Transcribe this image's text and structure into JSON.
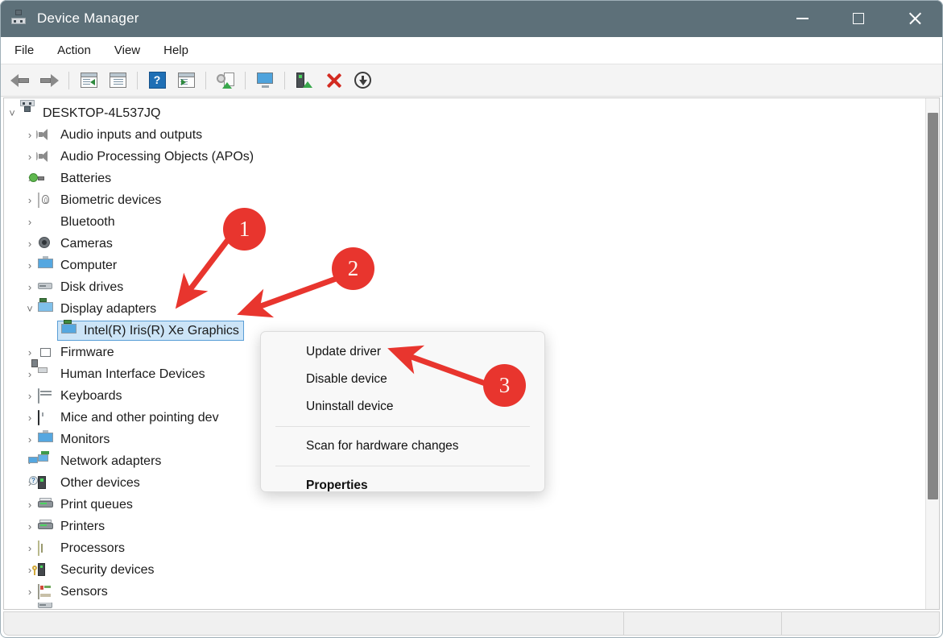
{
  "window": {
    "title": "Device Manager",
    "icon": "device-manager-icon",
    "controls": {
      "minimize": "minimize-icon",
      "maximize": "maximize-icon",
      "close": "close-icon"
    },
    "titlebar_color": "#5d7079"
  },
  "menubar": {
    "items": [
      {
        "label": "File"
      },
      {
        "label": "Action"
      },
      {
        "label": "View"
      },
      {
        "label": "Help"
      }
    ]
  },
  "toolbar": {
    "buttons": [
      {
        "name": "back-button",
        "icon": "back-arrow-icon"
      },
      {
        "name": "forward-button",
        "icon": "forward-arrow-icon"
      },
      {
        "name": "show-hide-console-tree-button",
        "icon": "console-tree-icon"
      },
      {
        "name": "properties-button",
        "icon": "properties-window-icon"
      },
      {
        "name": "help-button",
        "icon": "question-mark-icon"
      },
      {
        "name": "show-hide-action-pane-button",
        "icon": "action-pane-icon"
      },
      {
        "name": "update-driver-button",
        "icon": "update-driver-icon"
      },
      {
        "name": "scan-hardware-changes-button",
        "icon": "scan-monitor-icon"
      },
      {
        "name": "enable-device-button",
        "icon": "enable-device-icon"
      },
      {
        "name": "uninstall-device-button",
        "icon": "red-x-icon"
      },
      {
        "name": "disable-device-button",
        "icon": "down-arrow-circle-icon"
      }
    ]
  },
  "tree": {
    "root": {
      "label": "DESKTOP-4L537JQ",
      "icon": "computer-device-icon",
      "expanded": true
    },
    "items": [
      {
        "label": "Audio inputs and outputs",
        "icon": "speaker-icon",
        "expanded": false
      },
      {
        "label": "Audio Processing Objects (APOs)",
        "icon": "speaker-icon",
        "expanded": false
      },
      {
        "label": "Batteries",
        "icon": "battery-icon",
        "expanded": false
      },
      {
        "label": "Biometric devices",
        "icon": "fingerprint-icon",
        "expanded": false
      },
      {
        "label": "Bluetooth",
        "icon": "bluetooth-icon",
        "expanded": false
      },
      {
        "label": "Cameras",
        "icon": "camera-icon",
        "expanded": false
      },
      {
        "label": "Computer",
        "icon": "monitor-icon",
        "expanded": false
      },
      {
        "label": "Disk drives",
        "icon": "disk-drive-icon",
        "expanded": false
      },
      {
        "label": "Display adapters",
        "icon": "display-adapter-icon",
        "expanded": true
      },
      {
        "label": "Firmware",
        "icon": "firmware-chip-icon",
        "expanded": false
      },
      {
        "label": "Human Interface Devices",
        "icon": "hid-icon",
        "expanded": false
      },
      {
        "label": "Keyboards",
        "icon": "keyboard-icon",
        "expanded": false
      },
      {
        "label": "Mice and other pointing dev",
        "icon": "mouse-icon",
        "expanded": false
      },
      {
        "label": "Monitors",
        "icon": "monitor-icon",
        "expanded": false
      },
      {
        "label": "Network adapters",
        "icon": "network-adapter-icon",
        "expanded": false
      },
      {
        "label": "Other devices",
        "icon": "unknown-device-icon",
        "expanded": false
      },
      {
        "label": "Print queues",
        "icon": "printer-icon",
        "expanded": false
      },
      {
        "label": "Printers",
        "icon": "printer-icon",
        "expanded": false
      },
      {
        "label": "Processors",
        "icon": "processor-chip-icon",
        "expanded": false
      },
      {
        "label": "Security devices",
        "icon": "security-device-icon",
        "expanded": false
      },
      {
        "label": "Sensors",
        "icon": "sensor-icon",
        "expanded": false
      }
    ],
    "selected_child": {
      "label": "Intel(R) Iris(R) Xe Graphics",
      "icon": "display-adapter-icon",
      "selected": true
    }
  },
  "context_menu": {
    "items": [
      {
        "label": "Update driver",
        "bold": false
      },
      {
        "label": "Disable device",
        "bold": false
      },
      {
        "label": "Uninstall device",
        "bold": false
      },
      {
        "separator_after": true
      },
      {
        "label": "Scan for hardware changes",
        "bold": false
      },
      {
        "separator_after": true
      },
      {
        "label": "Properties",
        "bold": true
      }
    ]
  },
  "annotations": {
    "color": "#e8352e",
    "badges": [
      {
        "number": "1",
        "target": "display-adapters-row"
      },
      {
        "number": "2",
        "target": "display-adapters-row"
      },
      {
        "number": "3",
        "target": "update-driver-menu-item"
      }
    ]
  },
  "statusbar": {
    "segments": [
      "",
      "",
      ""
    ]
  }
}
